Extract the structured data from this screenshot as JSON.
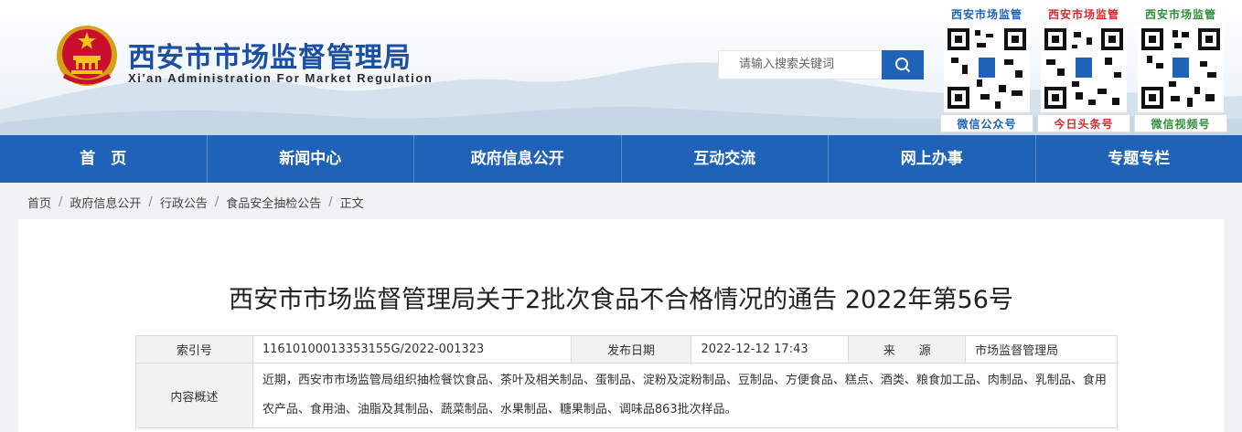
{
  "header": {
    "title": "西安市市场监督管理局",
    "subtitle": "Xi'an Administration For Market Regulation",
    "search_placeholder": "请输入搜索关键词",
    "qr_codes": [
      {
        "title": "西安市场监管",
        "caption": "微信公众号",
        "title_color": "#1e63b8"
      },
      {
        "title": "西安市场监管",
        "caption": "今日头条号",
        "title_color": "#d7282f"
      },
      {
        "title": "西安市场监管",
        "caption": "微信视频号",
        "title_color": "#2f8f3a"
      }
    ]
  },
  "nav": {
    "items": [
      "首　页",
      "新闻中心",
      "政府信息公开",
      "互动交流",
      "网上办事",
      "专题专栏"
    ]
  },
  "breadcrumb": [
    "首页",
    "政府信息公开",
    "行政公告",
    "食品安全抽检公告",
    "正文"
  ],
  "article": {
    "title": "西安市市场监督管理局关于2批次食品不合格情况的通告 2022年第56号",
    "meta": {
      "index_label": "索引号",
      "index_value": "11610100013353155G/2022-001323",
      "date_label": "发布日期",
      "date_value": "2022-12-12 17:43",
      "source_label": "来　　源",
      "source_value": "市场监督管理局",
      "summary_label": "内容概述",
      "summary_value": "近期，西安市市场监管局组织抽检餐饮食品、茶叶及相关制品、蛋制品、淀粉及淀粉制品、豆制品、方便食品、糕点、酒类、粮食加工品、肉制品、乳制品、食用农产品、食用油、油脂及其制品、蔬菜制品、水果制品、糖果制品、调味品863批次样品。"
    }
  },
  "colors": {
    "brand_blue": "#1e63b8",
    "title_blue": "#1a4fa3"
  }
}
